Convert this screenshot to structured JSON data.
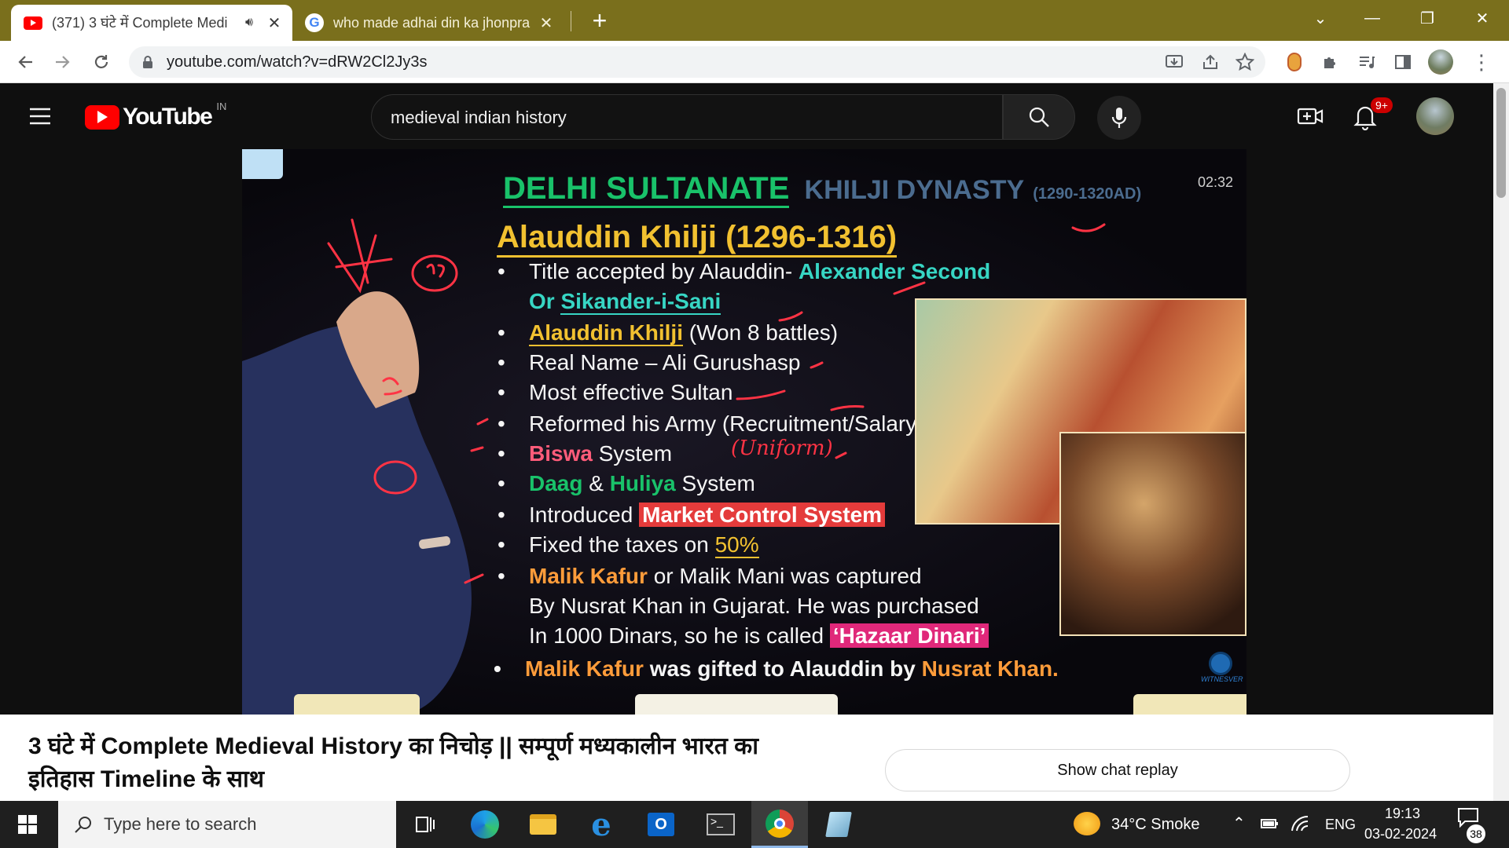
{
  "browser": {
    "tabs": [
      {
        "title": "(371) 3 घंटे में Complete Medi",
        "active": true
      },
      {
        "title": "who made adhai din ka jhonpra",
        "active": false
      }
    ],
    "new_tab_label": "+",
    "window_controls": {
      "dropdown": "⌄",
      "minimize": "—",
      "restore": "❐",
      "close": "✕"
    },
    "url": "youtube.com/watch?v=dRW2Cl2Jy3s"
  },
  "youtube": {
    "brand": "YouTube",
    "country_code": "IN",
    "search_value": "medieval indian history",
    "notification_badge": "9+",
    "video": {
      "timer": "02:32",
      "heading_main": "DELHI SULTANATE",
      "heading_sub": "KHILJI DYNASTY",
      "heading_years": "(1290-1320AD)",
      "subheading": "Alauddin Khilji (1296-1316)",
      "handwritten_note": "(Uniform)",
      "watermark": "WITNESVER",
      "lines": [
        {
          "parts": [
            "Title accepted by Alauddin- ",
            "Alexander Second"
          ]
        },
        {
          "parts": [
            "Or ",
            "Sikander-i-Sani"
          ],
          "no_bullet": true
        },
        {
          "parts": [
            "Alauddin Khilji",
            " (Won 8 battles)"
          ]
        },
        {
          "parts": [
            "Real Name – Ali Gurushasp"
          ]
        },
        {
          "parts": [
            "Most effective Sultan"
          ]
        },
        {
          "parts": [
            "Reformed his Army (Recruitment/Salary)"
          ]
        },
        {
          "parts": [
            "Biswa",
            " System"
          ]
        },
        {
          "parts": [
            "Daag",
            " & ",
            "Huliya",
            " System"
          ]
        },
        {
          "parts": [
            "Introduced ",
            "Market Control System"
          ]
        },
        {
          "parts": [
            "Fixed the taxes on ",
            "50%"
          ]
        },
        {
          "parts": [
            "Malik Kafur",
            " or Malik Mani was captured"
          ]
        },
        {
          "parts": [
            "By Nusrat Khan in Gujarat. He was purchased"
          ],
          "no_bullet": true
        },
        {
          "parts": [
            "In 1000 Dinars, so he is called ",
            "‘Hazaar Dinari’"
          ],
          "no_bullet": true
        },
        {
          "parts": [
            "Malik Kafur",
            " was gifted to Alauddin by ",
            "Nusrat Khan."
          ]
        }
      ]
    },
    "video_title": "3 घंटे में Complete Medieval History का निचोड़ || सम्पूर्ण मध्यकालीन भारत का इतिहास Timeline के साथ",
    "chat_button": "Show chat replay"
  },
  "taskbar": {
    "search_placeholder": "Type here to search",
    "weather": "34°C  Smoke",
    "language": "ENG",
    "time": "19:13",
    "date": "03-02-2024",
    "notification_count": "38"
  }
}
